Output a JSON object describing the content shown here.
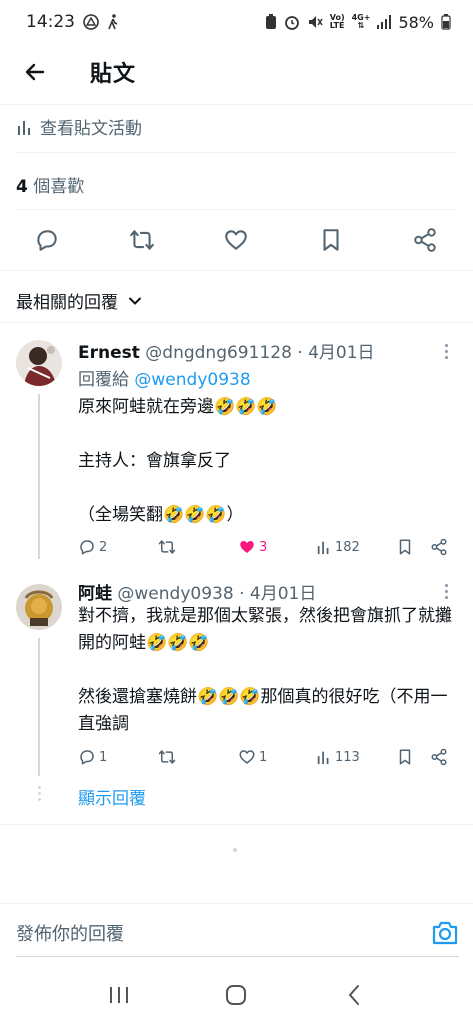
{
  "status": {
    "time": "14:23",
    "battery": "58%",
    "net_top": "Vo)",
    "net_bot": "LTE",
    "sig_top": "4G+"
  },
  "header": {
    "title": "貼文"
  },
  "activity": {
    "label": "查看貼文活動"
  },
  "likes": {
    "count": "4",
    "label": " 個喜歡"
  },
  "sort": {
    "label": "最相關的回覆"
  },
  "replies": [
    {
      "name": "Ernest",
      "handle": "@dngdng691128",
      "date": " · 4月01日",
      "reply_prefix": "回覆給 ",
      "reply_to": "@wendy0938",
      "lines": [
        "原來阿蛙就在旁邊🤣🤣🤣",
        "",
        "主持人：會旗拿反了",
        "",
        "（全場笑翻🤣🤣🤣）"
      ],
      "replies_count": "2",
      "retweets_count": "",
      "likes_count": "3",
      "views_count": "182"
    },
    {
      "name": "阿蛙",
      "handle": "@wendy0938",
      "date": " · 4月01日",
      "lines": [
        "對不擠，我就是那個太緊張，然後把會旗抓了就攤開的阿蛙🤣🤣🤣",
        "",
        "然後還搶塞燒餅🤣🤣🤣那個真的很好吃（不用一直強調"
      ],
      "replies_count": "1",
      "retweets_count": "",
      "likes_count": "1",
      "views_count": "113"
    }
  ],
  "show_replies": "顯示回覆",
  "composer": {
    "placeholder": "發佈你的回覆"
  },
  "colors": {
    "accent": "#1d9bf0",
    "like": "#f91880",
    "muted": "#536471",
    "text": "#0f1419"
  },
  "icons": [
    "back-arrow-icon",
    "stats-icon",
    "reply-icon",
    "retweet-icon",
    "heart-icon",
    "bookmark-icon",
    "share-icon",
    "chevron-down-icon",
    "more-icon",
    "camera-icon"
  ]
}
